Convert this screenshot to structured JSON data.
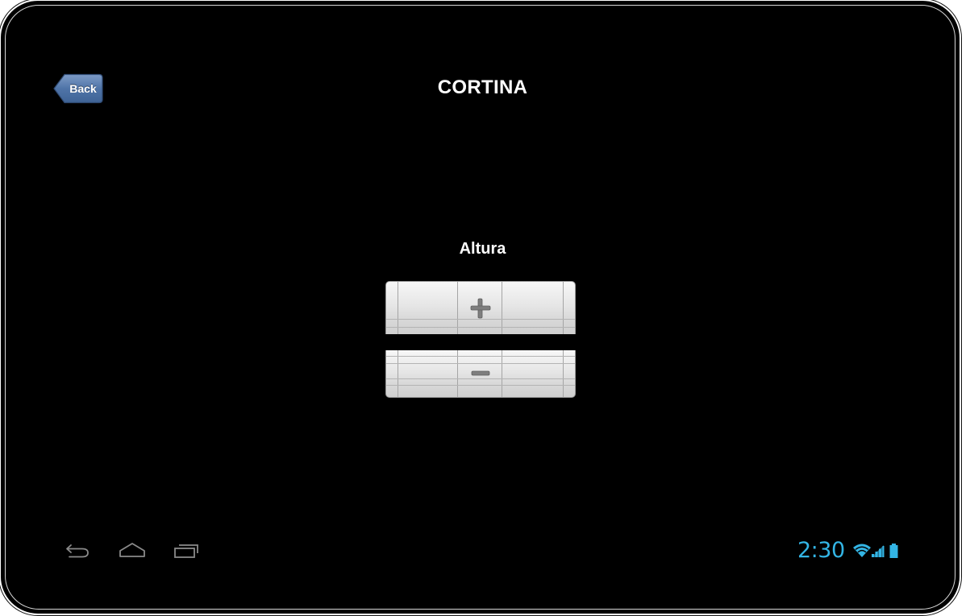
{
  "header": {
    "back_label": "Back",
    "title": "CORTINA"
  },
  "control": {
    "label": "Altura",
    "increase_symbol": "plus-icon",
    "decrease_symbol": "minus-icon"
  },
  "system_bar": {
    "time": "2:30",
    "accent_color": "#33b5e5",
    "nav_icons": [
      "back-icon",
      "home-icon",
      "recent-apps-icon"
    ],
    "status_icons": [
      "wifi-icon",
      "signal-icon",
      "battery-icon"
    ]
  },
  "colors": {
    "background": "#000000",
    "back_button": "#4a6ea0",
    "text": "#ffffff"
  }
}
